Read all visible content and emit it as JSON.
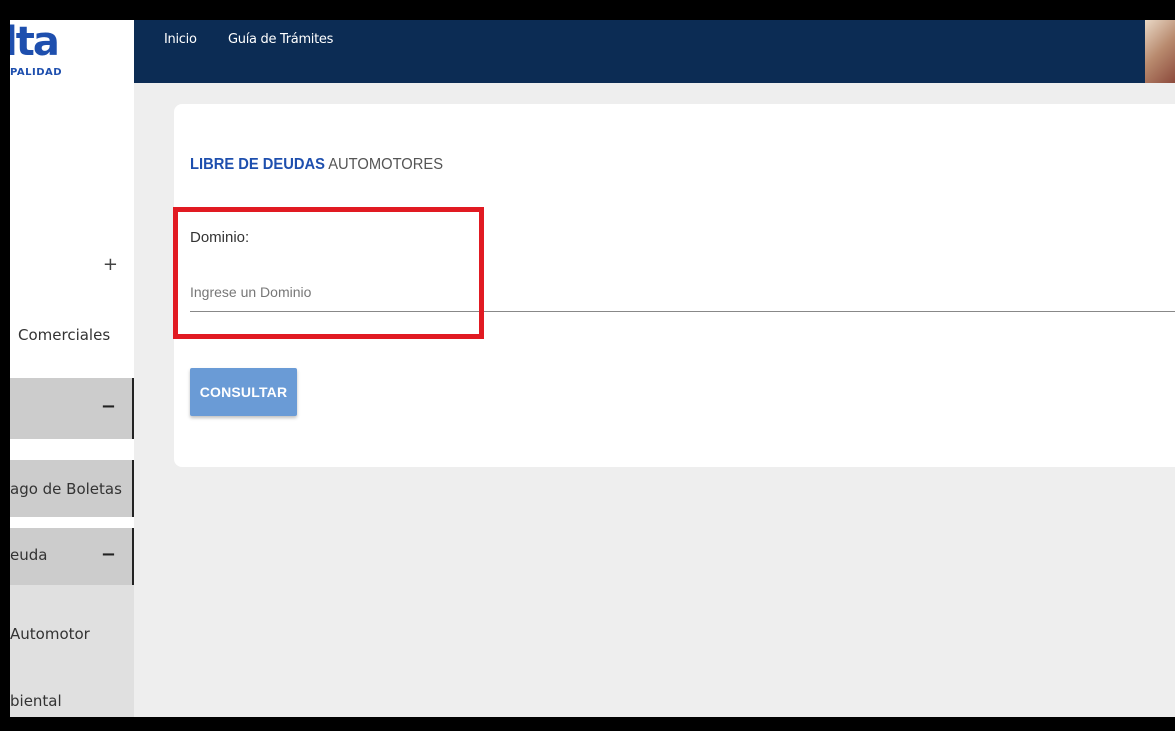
{
  "logo": {
    "word": "lta",
    "subtitle": "PALIDAD"
  },
  "sidebar": {
    "plus": "+",
    "items": [
      {
        "label": "Comerciales"
      },
      {
        "label": "",
        "toggle": "−"
      },
      {
        "label": "ago de Boletas"
      },
      {
        "label": "euda",
        "toggle": "−"
      },
      {
        "label": "Automotor"
      },
      {
        "label": "biental"
      }
    ]
  },
  "nav": {
    "inicio": "Inicio",
    "guia": "Guía de Trámites"
  },
  "card": {
    "title_strong": "LIBRE DE DEUDAS",
    "title_rest": "AUTOMOTORES",
    "field_label": "Dominio:",
    "field_placeholder": "Ingrese un Dominio",
    "field_value": "",
    "button_label": "CONSULTAR"
  },
  "colors": {
    "brand": "#1e4fae",
    "topbar": "#0c2c54",
    "button": "#6a9bd6",
    "highlight": "#e11a22"
  }
}
